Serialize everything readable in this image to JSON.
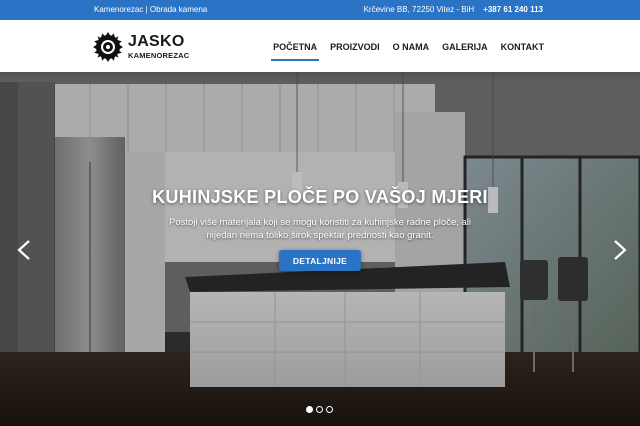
{
  "topbar": {
    "company": "Kamenorezac | Obrada kamena",
    "address": "Krčevine BB, 72250 Vitez - BiH",
    "phone": "+387 61 240 113"
  },
  "logo": {
    "title": "JASKO",
    "subtitle": "KAMENOREZAC"
  },
  "nav": {
    "items": [
      {
        "label": "POČETNA",
        "active": true
      },
      {
        "label": "PROIZVODI",
        "active": false
      },
      {
        "label": "O NAMA",
        "active": false
      },
      {
        "label": "GALERIJA",
        "active": false
      },
      {
        "label": "KONTAKT",
        "active": false
      }
    ]
  },
  "hero": {
    "title": "KUHINJSKE PLOČE PO VAŠOJ MJERI",
    "text": "Postoji više materijala koji se mogu koristiti za kuhinjske radne ploče, ali nijedan nema toliko širok spektar prednosti kao granit.",
    "button_label": "DETALJNIJE",
    "prev_icon": "chevron-left-icon",
    "next_icon": "chevron-right-icon",
    "slides_count": 3,
    "active_slide": 1
  },
  "colors": {
    "accent": "#2b74c5",
    "text_dark": "#1c1c1c",
    "white": "#ffffff"
  }
}
